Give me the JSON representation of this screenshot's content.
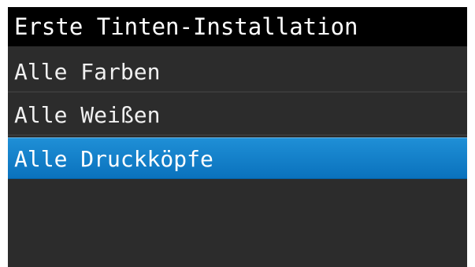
{
  "screen": {
    "title": "Erste Tinten-Installation",
    "menu_items": [
      {
        "label": "Alle Farben",
        "selected": false
      },
      {
        "label": "Alle Weißen",
        "selected": false
      },
      {
        "label": "Alle Druckköpfe",
        "selected": true
      }
    ]
  },
  "colors": {
    "title_background": "#000000",
    "screen_background": "#2c2c2c",
    "selection_highlight": "#1586cf",
    "text": "#ffffff"
  }
}
